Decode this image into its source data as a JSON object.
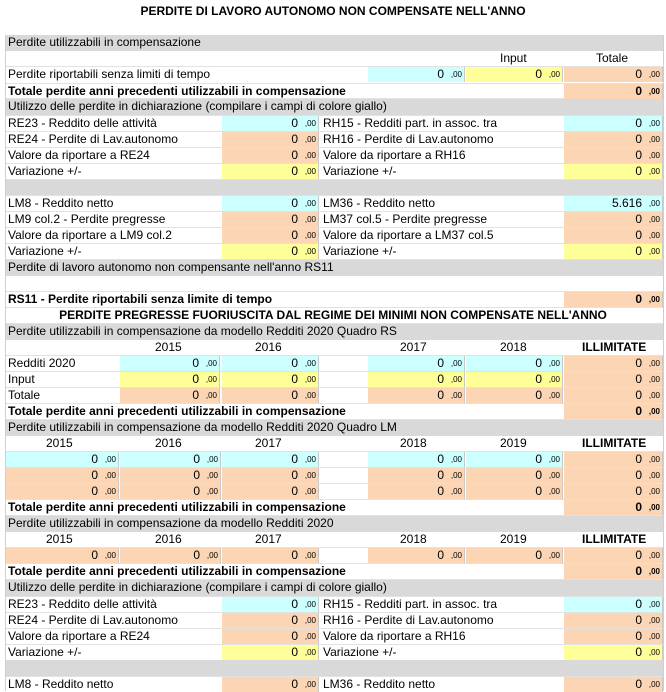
{
  "title": "PERDITE DI LAVORO AUTONOMO NON COMPENSATE NELL'ANNO",
  "title2": "PERDITE PREGRESSE FUORIUSCITA DAL REGIME DEI MINIMI NON COMPENSATE NELL'ANNO",
  "decimal": ",00",
  "s1": {
    "header": "Perdite utilizzabili in compensazione",
    "col_input": "Input",
    "col_totale": "Totale",
    "row_label": "Perdite riportabili senza limiti di tempo",
    "row_vals": [
      "0",
      "0",
      "0"
    ],
    "totale_label": "Totale perdite anni precedenti utilizzabili in compensazione",
    "totale_val": "0"
  },
  "s2": {
    "header": "Utilizzo delle perdite in dichiarazione (compilare i campi di colore giallo)",
    "left": [
      {
        "label": "RE23 - Reddito delle attività",
        "val": "0"
      },
      {
        "label": "RE24 - Perdite di Lav.autonomo",
        "val": "0"
      },
      {
        "label": "Valore da riportare a RE24",
        "val": "0"
      },
      {
        "label": "Variazione +/-",
        "val": "0"
      }
    ],
    "right": [
      {
        "label": "RH15 - Redditi  part. in assoc. tra",
        "val": "0"
      },
      {
        "label": "RH16 - Perdite di Lav.autonomo",
        "val": "0"
      },
      {
        "label": "Valore da riportare a RH16",
        "val": "0"
      },
      {
        "label": "Variazione +/-",
        "val": "0"
      }
    ]
  },
  "s3": {
    "left": [
      {
        "label": "LM8 - Reddito netto",
        "val": "0"
      },
      {
        "label": "LM9 col.2 - Perdite pregresse",
        "val": "0"
      },
      {
        "label": "Valore da riportare a LM9 col.2",
        "val": "0"
      },
      {
        "label": "Variazione +/-",
        "val": "0"
      }
    ],
    "right": [
      {
        "label": "LM36 - Reddito netto",
        "val": "5.616"
      },
      {
        "label": "LM37 col.5 - Perdite pregresse",
        "val": "0"
      },
      {
        "label": "Valore da riportare a LM37 col.5",
        "val": "0"
      },
      {
        "label": "Variazione +/-",
        "val": "0"
      }
    ]
  },
  "rs11": {
    "header": "Perdite di lavoro autonomo non compensante nell'anno RS11",
    "label": "RS11 - Perdite riportabili senza limite di tempo",
    "val": "0"
  },
  "rs": {
    "header": "Perdite utilizzabili in compensazione da modello Redditi 2020 Quadro RS",
    "years": [
      "2015",
      "2016",
      "2017",
      "2018",
      "ILLIMITATE"
    ],
    "rows": [
      {
        "label": "Redditi 2020",
        "vals": [
          "0",
          "0",
          "0",
          "0",
          "0"
        ]
      },
      {
        "label": "Input",
        "vals": [
          "0",
          "0",
          "0",
          "0",
          "0"
        ]
      },
      {
        "label": "Totale",
        "vals": [
          "0",
          "0",
          "0",
          "0",
          "0"
        ]
      }
    ],
    "totale_label": "Totale perdite anni precedenti utilizzabili in compensazione",
    "totale_val": "0"
  },
  "lm": {
    "header": "Perdite utilizzabili in compensazione da modello Redditi 2020 Quadro LM",
    "years": [
      "2015",
      "2016",
      "2017",
      "2018",
      "2019",
      "ILLIMITATE"
    ],
    "rows": [
      [
        "0",
        "0",
        "0",
        "0",
        "0",
        "0"
      ],
      [
        "0",
        "0",
        "0",
        "0",
        "0",
        "0"
      ],
      [
        "0",
        "0",
        "0",
        "0",
        "0",
        "0"
      ]
    ],
    "totale_label": "Totale perdite anni precedenti utilizzabili in compensazione",
    "totale_val": "0"
  },
  "r2020": {
    "header": "Perdite utilizzabili in compensazione da modello Redditi 2020",
    "years": [
      "2015",
      "2016",
      "2017",
      "2018",
      "2019",
      "ILLIMITATE"
    ],
    "vals": [
      "0",
      "0",
      "0",
      "0",
      "0",
      "0"
    ],
    "totale_label": "Totale perdite anni precedenti utilizzabili in compensazione",
    "totale_val": "0"
  },
  "s4": {
    "header": "Utilizzo delle perdite in dichiarazione (compilare i campi di colore giallo)",
    "left": [
      {
        "label": "RE23 - Reddito delle attività",
        "val": "0"
      },
      {
        "label": "RE24 - Perdite di Lav.autonomo",
        "val": "0"
      },
      {
        "label": "Valore da riportare a RE24",
        "val": "0"
      },
      {
        "label": "Variazione +/-",
        "val": "0"
      }
    ],
    "right": [
      {
        "label": "RH15 - Redditi  part. in assoc. tra",
        "val": "0"
      },
      {
        "label": "RH16 - Perdite di Lav.autonomo",
        "val": "0"
      },
      {
        "label": "Valore da riportare a RH16",
        "val": "0"
      },
      {
        "label": "Variazione +/-",
        "val": "0"
      }
    ]
  },
  "s5": {
    "left": {
      "label": "LM8 - Reddito netto",
      "val": "0"
    },
    "right": {
      "label": "LM36 - Reddito netto",
      "val": "0"
    }
  },
  "colors": {
    "cyan": "#ccffff",
    "yellow": "#ffff99",
    "peach": "#fcd5b4",
    "band": "#d9d9d9"
  }
}
